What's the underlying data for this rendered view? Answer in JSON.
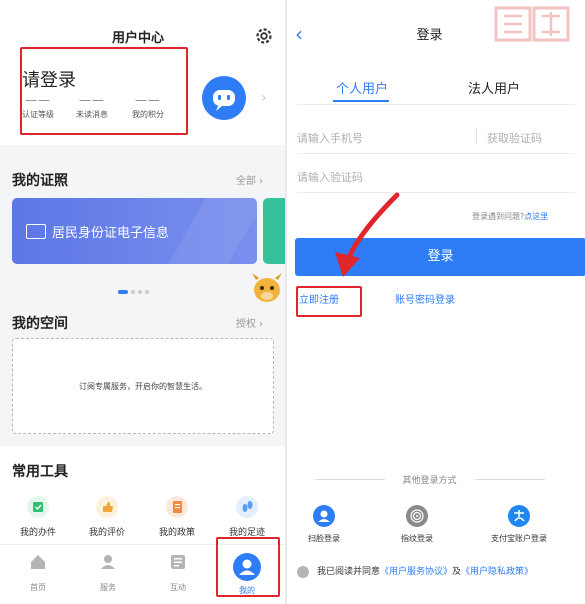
{
  "colors": {
    "accent": "#2e7cf6",
    "highlight": "#e0262b",
    "id_card": "#6a82ea",
    "next_card": "#35c29a"
  },
  "left": {
    "title": "用户中心",
    "login_prompt": "请登录",
    "stats": [
      {
        "value": "——",
        "label": "认证等级"
      },
      {
        "value": "——",
        "label": "未读消息"
      },
      {
        "value": "——",
        "label": "我的积分"
      }
    ],
    "licenses": {
      "title": "我的证照",
      "more": "全部",
      "card_text": "居民身份证电子信息"
    },
    "space": {
      "title": "我的空间",
      "more": "授权",
      "empty_msg": "订阅专属服务，开启你的智慧生活。"
    },
    "tools": {
      "title": "常用工具",
      "items": [
        {
          "label": "我的办件",
          "icon": "calendar-check-icon"
        },
        {
          "label": "我的评价",
          "icon": "thumbs-up-icon"
        },
        {
          "label": "我的政策",
          "icon": "document-icon"
        },
        {
          "label": "我的足迹",
          "icon": "footprint-icon"
        }
      ]
    },
    "tabbar": [
      {
        "label": "首页",
        "icon": "home-icon"
      },
      {
        "label": "服务",
        "icon": "service-icon"
      },
      {
        "label": "互动",
        "icon": "interaction-icon"
      },
      {
        "label": "我的",
        "icon": "user-icon"
      }
    ]
  },
  "right": {
    "title": "登录",
    "tabs": [
      "个人用户",
      "法人用户"
    ],
    "phone_placeholder": "请输入手机号",
    "get_code": "获取验证码",
    "code_placeholder": "请输入验证码",
    "problem_text": "登录遇到问题?",
    "problem_link": "点这里",
    "login_button": "登录",
    "register": "立即注册",
    "password_login": "账号密码登录",
    "other_title": "其他登录方式",
    "other_logins": [
      {
        "label": "扫脸登录",
        "icon": "face-scan-icon"
      },
      {
        "label": "指纹登录",
        "icon": "fingerprint-icon"
      },
      {
        "label": "支付宝账户登录",
        "icon": "alipay-icon"
      }
    ],
    "agreement": {
      "prefix": "我已阅读并同意",
      "link1": "《用户服务协议》",
      "mid": "及",
      "link2": "《用户隐私政策》"
    }
  }
}
